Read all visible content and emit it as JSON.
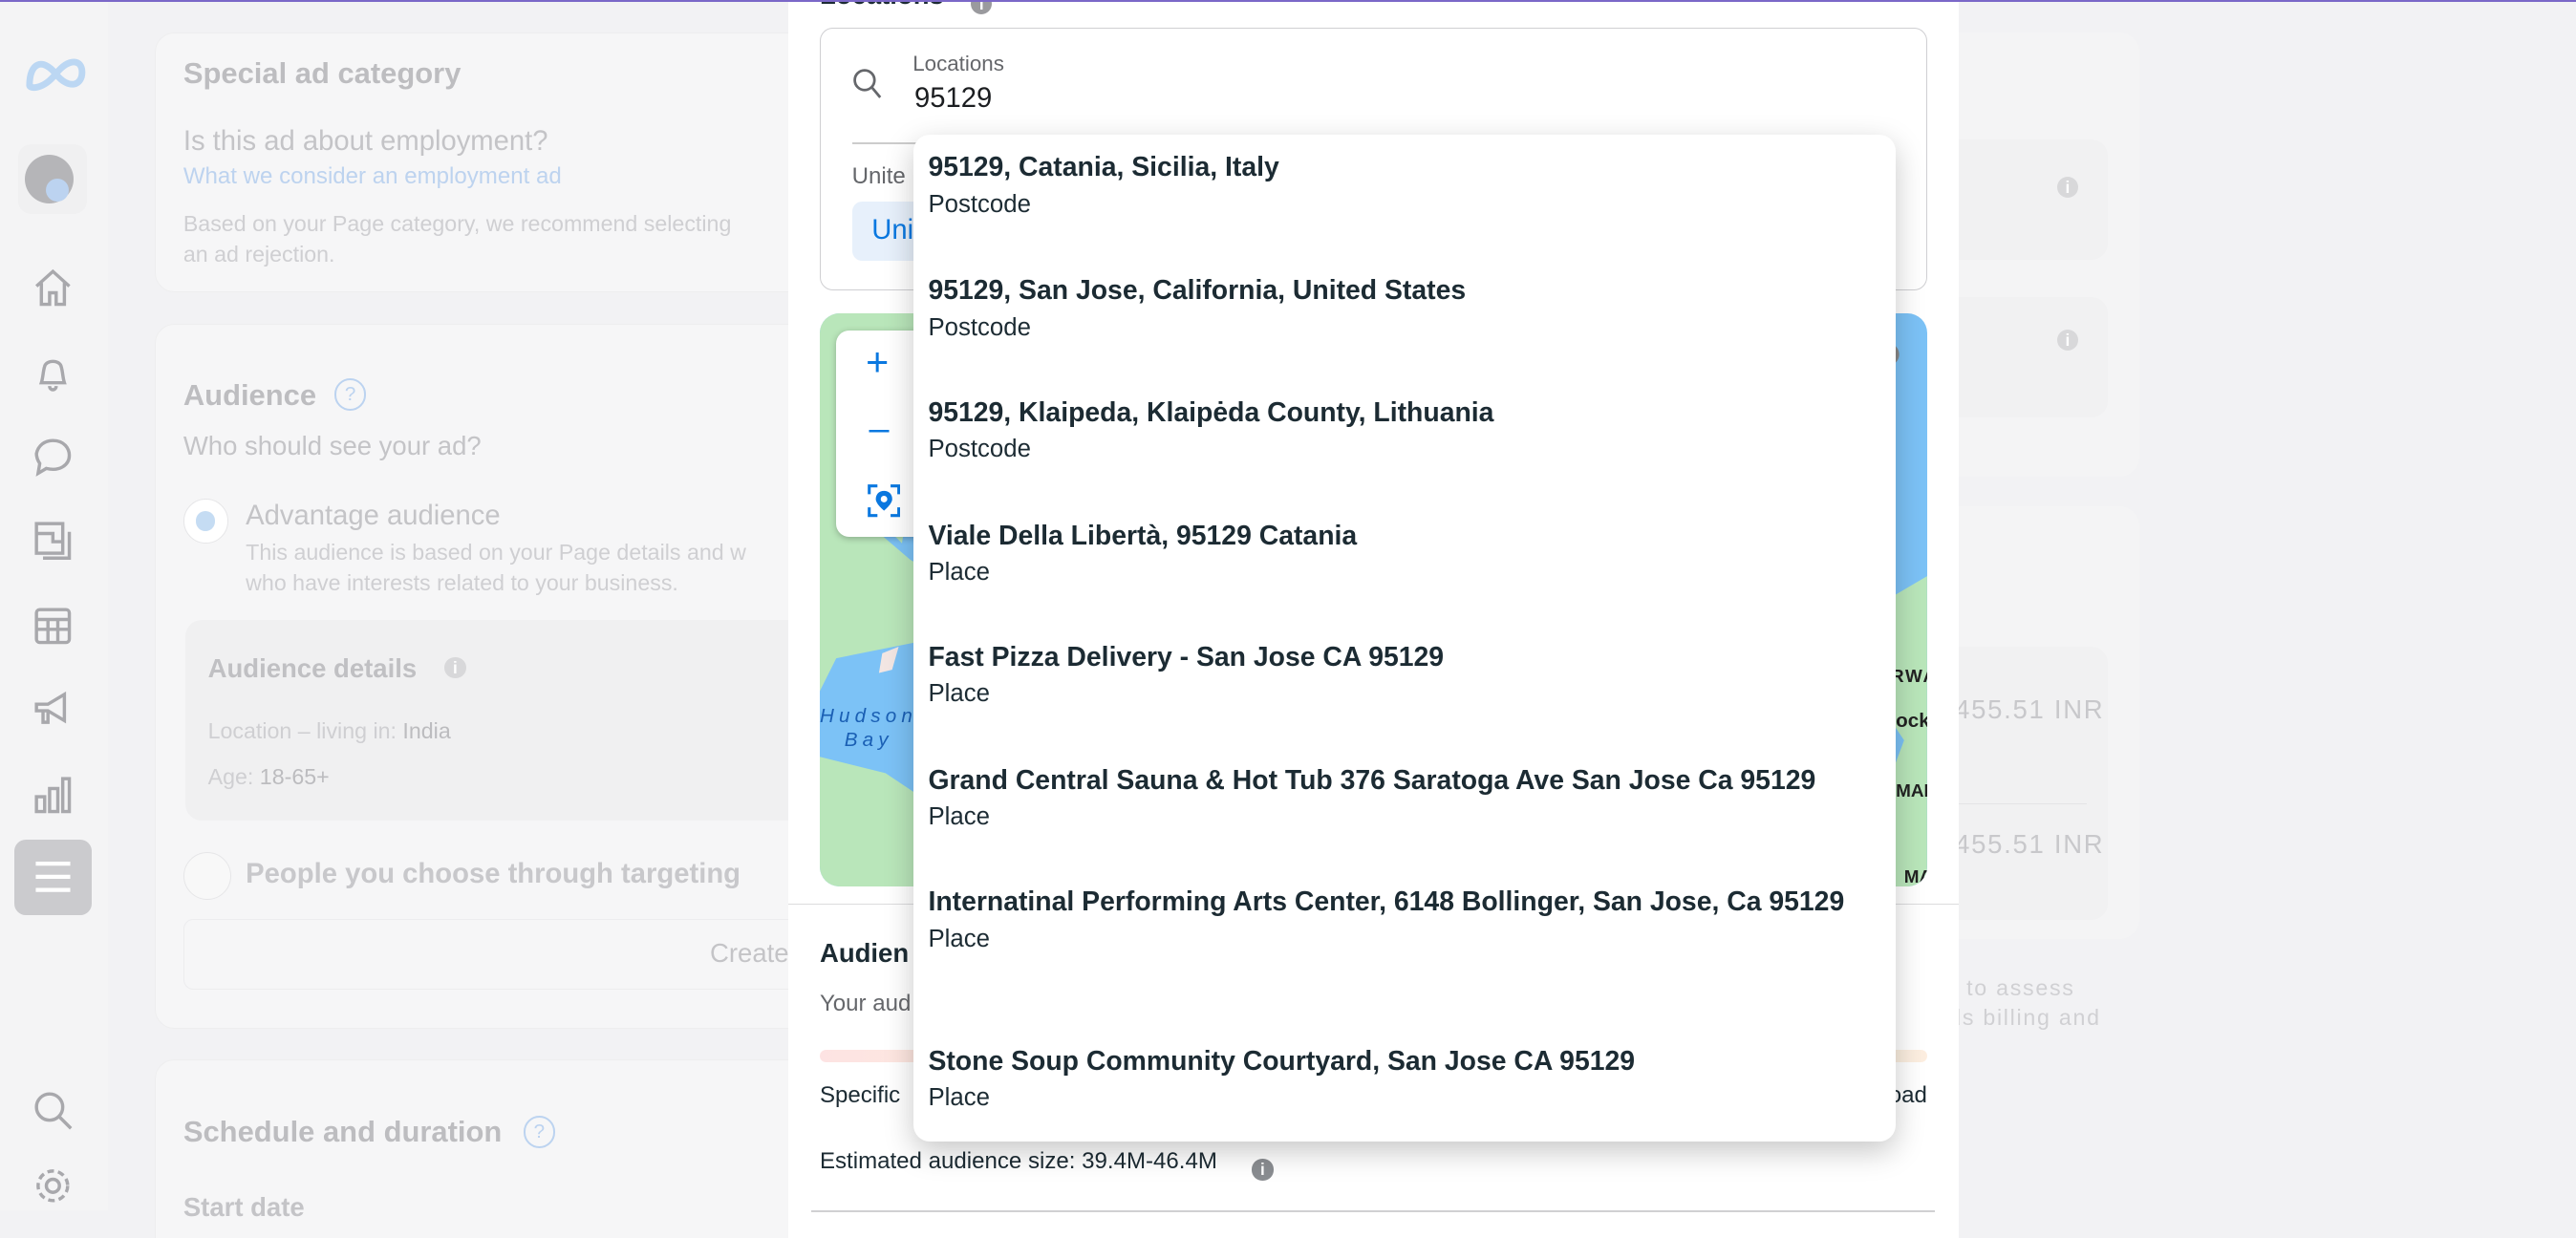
{
  "colors": {
    "accent": "#0a78e0",
    "top_border": "#7b68c8",
    "map_water": "#7cc2f6",
    "map_land": "#b9e6ba"
  },
  "sidebar": {
    "items": [
      {
        "icon": "meta-logo-icon"
      },
      {
        "icon": "account-avatar"
      },
      {
        "icon": "home-icon"
      },
      {
        "icon": "bell-icon"
      },
      {
        "icon": "chat-icon"
      },
      {
        "icon": "pages-icon"
      },
      {
        "icon": "table-icon"
      },
      {
        "icon": "megaphone-icon"
      },
      {
        "icon": "bar-chart-icon"
      },
      {
        "icon": "menu-icon",
        "active": true
      },
      {
        "icon": "search-icon"
      },
      {
        "icon": "gear-icon"
      }
    ]
  },
  "background": {
    "special": {
      "title": "Special ad category",
      "question": "Is this ad about employment?",
      "link": "What we consider an employment ad",
      "desc1": "Based on your Page category, we recommend selecting",
      "desc2": "an ad rejection."
    },
    "audience": {
      "title": "Audience",
      "question": "Who should see your ad?",
      "option1": "Advantage audience",
      "option1_desc1": "This audience is based on your Page details and w",
      "option1_desc2": "who have interests related to your business.",
      "details_title": "Audience details",
      "location_label": "Location – living in: ",
      "location_value": "India",
      "age_label": "Age: ",
      "age_value": "18-65+",
      "option2": "People you choose through targeting",
      "create_label": "Create"
    },
    "schedule": {
      "title": "Schedule and duration",
      "start_date": "Start date"
    },
    "right": {
      "amount1": "455.51 INR",
      "amount2": "455.51 INR",
      "note1": "to assess",
      "note2": "ds billing and"
    }
  },
  "modal": {
    "section_label": "Locations",
    "search": {
      "label": "Locations",
      "value": "95129"
    },
    "selected_heading": "Unite",
    "selected_chip": "Uni",
    "map": {
      "labels": [
        "Hudson",
        "Bay",
        "RWA",
        "ock",
        "MAR",
        "MA"
      ],
      "zoom_in": "+",
      "zoom_out": "–"
    },
    "audience": {
      "title": "Audien",
      "desc": "Your aud",
      "specific": "Specific",
      "broad": "oad",
      "estimated": "Estimated audience size: 39.4M-46.4M"
    },
    "dropdown": [
      {
        "title": "95129, Catania, Sicilia, Italy",
        "type": "Postcode"
      },
      {
        "title": "95129, San Jose, California, United States",
        "type": "Postcode"
      },
      {
        "title": "95129, Klaipeda, Klaipėda County, Lithuania",
        "type": "Postcode"
      },
      {
        "title": "Viale Della Libertà, 95129 Catania",
        "type": "Place"
      },
      {
        "title": "Fast Pizza Delivery - San Jose CA 95129",
        "type": "Place"
      },
      {
        "title": "Grand Central Sauna & Hot Tub 376 Saratoga Ave San Jose Ca 95129",
        "type": "Place"
      },
      {
        "title": "Internatinal Performing Arts Center, 6148 Bollinger, San Jose, Ca 95129",
        "type": "Place"
      },
      {
        "title": "Stone Soup Community Courtyard, San Jose CA 95129",
        "type": "Place"
      }
    ]
  }
}
